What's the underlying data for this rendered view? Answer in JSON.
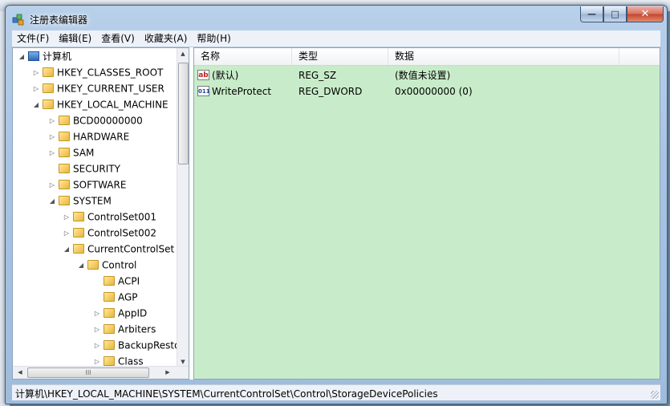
{
  "window": {
    "title": "注册表编辑器",
    "controls": {
      "minimize": "—",
      "maximize": "□",
      "close": "✕"
    }
  },
  "menu": [
    {
      "label": "文件(F)"
    },
    {
      "label": "编辑(E)"
    },
    {
      "label": "查看(V)"
    },
    {
      "label": "收藏夹(A)"
    },
    {
      "label": "帮助(H)"
    }
  ],
  "tree": {
    "nodes": [
      {
        "label": "计算机",
        "expander": "◢",
        "icon": "computer-icon"
      },
      {
        "label": "HKEY_CLASSES_ROOT",
        "expander": "▷"
      },
      {
        "label": "HKEY_CURRENT_USER",
        "expander": "▷"
      },
      {
        "label": "HKEY_LOCAL_MACHINE",
        "expander": "◢"
      },
      {
        "label": "BCD00000000",
        "expander": "▷"
      },
      {
        "label": "HARDWARE",
        "expander": "▷"
      },
      {
        "label": "SAM",
        "expander": "▷"
      },
      {
        "label": "SECURITY",
        "expander": ""
      },
      {
        "label": "SOFTWARE",
        "expander": "▷"
      },
      {
        "label": "SYSTEM",
        "expander": "◢"
      },
      {
        "label": "ControlSet001",
        "expander": "▷"
      },
      {
        "label": "ControlSet002",
        "expander": "▷"
      },
      {
        "label": "CurrentControlSet",
        "expander": "◢"
      },
      {
        "label": "Control",
        "expander": "◢"
      },
      {
        "label": "ACPI",
        "expander": ""
      },
      {
        "label": "AGP",
        "expander": ""
      },
      {
        "label": "AppID",
        "expander": "▷"
      },
      {
        "label": "Arbiters",
        "expander": "▷"
      },
      {
        "label": "BackupRestore",
        "expander": "▷"
      },
      {
        "label": "Class",
        "expander": "▷"
      }
    ],
    "hscroll_thumb": "III"
  },
  "list": {
    "columns": [
      "名称",
      "类型",
      "数据"
    ],
    "rows": [
      {
        "icon": "ab",
        "name": "(默认)",
        "type": "REG_SZ",
        "data": "(数值未设置)"
      },
      {
        "icon": "011",
        "name": "WriteProtect",
        "type": "REG_DWORD",
        "data": "0x00000000 (0)"
      }
    ],
    "background": "#c8ecc9"
  },
  "status": {
    "path": "计算机\\HKEY_LOCAL_MACHINE\\SYSTEM\\CurrentControlSet\\Control\\StorageDevicePolicies"
  }
}
